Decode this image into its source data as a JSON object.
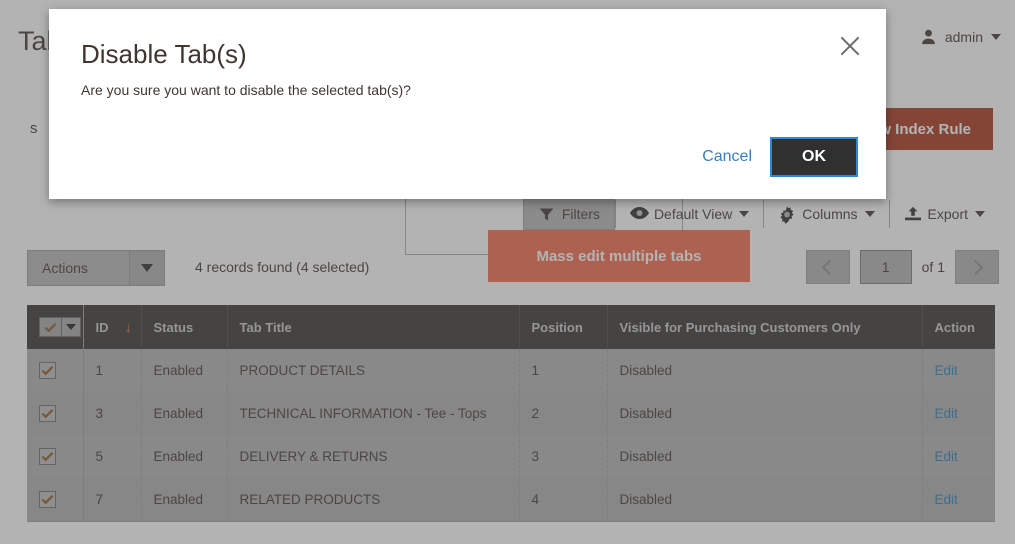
{
  "header": {
    "page_title": "Tabs",
    "admin_label": "admin",
    "admin_icon": "user-icon",
    "admin_caret_icon": "chevron-down-icon"
  },
  "search_band": {
    "search_label": "s",
    "add_rule_label": "Add New Index Rule"
  },
  "toolbar": {
    "filters": {
      "label": "Filters",
      "icon": "funnel-icon"
    },
    "default_view": {
      "label": "Default View",
      "icon": "eye-icon",
      "caret": "chevron-down-icon"
    },
    "columns": {
      "label": "Columns",
      "icon": "gear-icon",
      "caret": "chevron-down-icon"
    },
    "export": {
      "label": "Export",
      "icon": "upload-icon",
      "caret": "chevron-down-icon"
    }
  },
  "actions_row": {
    "actions_label": "Actions",
    "actions_caret_icon": "triangle-down-icon",
    "records_found": "4 records found (4 selected)"
  },
  "pagination": {
    "prev_icon": "chevron-left-icon",
    "next_icon": "chevron-right-icon",
    "current_page": "1",
    "of_label": "of 1"
  },
  "tooltip": {
    "text": "Mass edit multiple tabs",
    "background": "#f4694a",
    "color": "#ffffff"
  },
  "grid": {
    "columns": [
      {
        "key": "select",
        "label": ""
      },
      {
        "key": "id",
        "label": "ID"
      },
      {
        "key": "status",
        "label": "Status"
      },
      {
        "key": "title",
        "label": "Tab Title"
      },
      {
        "key": "position",
        "label": "Position"
      },
      {
        "key": "visible",
        "label": "Visible for Purchasing Customers Only"
      },
      {
        "key": "action",
        "label": "Action"
      }
    ],
    "sort_column": "ID",
    "sort_arrow": "↓",
    "select_all_checked": true,
    "rows": [
      {
        "checked": true,
        "id": "1",
        "status": "Enabled",
        "title": "PRODUCT DETAILS",
        "position": "1",
        "visible": "Disabled",
        "action": "Edit"
      },
      {
        "checked": true,
        "id": "3",
        "status": "Enabled",
        "title": "TECHNICAL INFORMATION - Tee - Tops",
        "position": "2",
        "visible": "Disabled",
        "action": "Edit"
      },
      {
        "checked": true,
        "id": "5",
        "status": "Enabled",
        "title": "DELIVERY & RETURNS",
        "position": "3",
        "visible": "Disabled",
        "action": "Edit"
      },
      {
        "checked": true,
        "id": "7",
        "status": "Enabled",
        "title": "RELATED PRODUCTS",
        "position": "4",
        "visible": "Disabled",
        "action": "Edit"
      }
    ]
  },
  "modal": {
    "title": "Disable Tab(s)",
    "message": "Are you sure you want to disable the selected tab(s)?",
    "cancel_label": "Cancel",
    "ok_label": "OK",
    "close_icon": "close-icon"
  },
  "colors": {
    "accent_orange": "#f4694a",
    "brand_red": "#a8341a",
    "header_dark": "#373330",
    "link_blue": "#2a7db1",
    "focus_blue": "#2f87d8"
  }
}
